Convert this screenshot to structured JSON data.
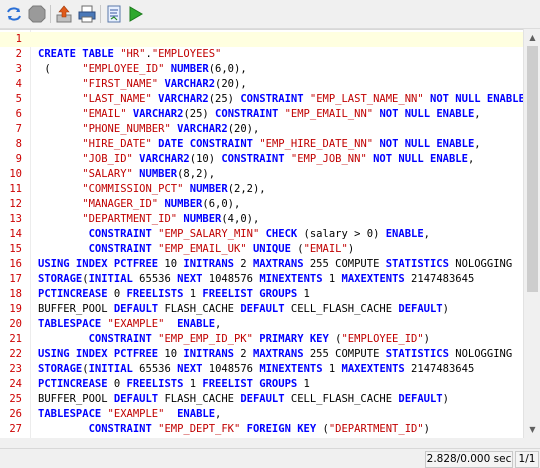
{
  "toolbar": {
    "buttons": [
      "refresh-icon",
      "stop-icon",
      "export-icon",
      "print-icon",
      "explain-plan-icon",
      "run-icon"
    ]
  },
  "editor": {
    "lines": [
      {
        "n": "1",
        "parts": []
      },
      {
        "n": "2",
        "parts": [
          [
            "k",
            "CREATE TABLE "
          ],
          [
            "s",
            "\"HR\""
          ],
          [
            "t",
            "."
          ],
          [
            "s",
            "\"EMPLOYEES\""
          ]
        ]
      },
      {
        "n": "3",
        "parts": [
          [
            "t",
            " (     "
          ],
          [
            "s",
            "\"EMPLOYEE_ID\""
          ],
          [
            "t",
            " "
          ],
          [
            "k",
            "NUMBER"
          ],
          [
            "t",
            "(6,0),"
          ]
        ]
      },
      {
        "n": "4",
        "parts": [
          [
            "t",
            "       "
          ],
          [
            "s",
            "\"FIRST_NAME\""
          ],
          [
            "t",
            " "
          ],
          [
            "k",
            "VARCHAR2"
          ],
          [
            "t",
            "(20),"
          ]
        ]
      },
      {
        "n": "5",
        "parts": [
          [
            "t",
            "       "
          ],
          [
            "s",
            "\"LAST_NAME\""
          ],
          [
            "t",
            " "
          ],
          [
            "k",
            "VARCHAR2"
          ],
          [
            "t",
            "(25) "
          ],
          [
            "k",
            "CONSTRAINT"
          ],
          [
            "t",
            " "
          ],
          [
            "s",
            "\"EMP_LAST_NAME_NN\""
          ],
          [
            "t",
            " "
          ],
          [
            "k",
            "NOT NULL"
          ],
          [
            "t",
            " "
          ],
          [
            "k",
            "ENABLE"
          ],
          [
            "t",
            ","
          ]
        ]
      },
      {
        "n": "6",
        "parts": [
          [
            "t",
            "       "
          ],
          [
            "s",
            "\"EMAIL\""
          ],
          [
            "t",
            " "
          ],
          [
            "k",
            "VARCHAR2"
          ],
          [
            "t",
            "(25) "
          ],
          [
            "k",
            "CONSTRAINT"
          ],
          [
            "t",
            " "
          ],
          [
            "s",
            "\"EMP_EMAIL_NN\""
          ],
          [
            "t",
            " "
          ],
          [
            "k",
            "NOT NULL"
          ],
          [
            "t",
            " "
          ],
          [
            "k",
            "ENABLE"
          ],
          [
            "t",
            ","
          ]
        ]
      },
      {
        "n": "7",
        "parts": [
          [
            "t",
            "       "
          ],
          [
            "s",
            "\"PHONE_NUMBER\""
          ],
          [
            "t",
            " "
          ],
          [
            "k",
            "VARCHAR2"
          ],
          [
            "t",
            "(20),"
          ]
        ]
      },
      {
        "n": "8",
        "parts": [
          [
            "t",
            "       "
          ],
          [
            "s",
            "\"HIRE_DATE\""
          ],
          [
            "t",
            " "
          ],
          [
            "k",
            "DATE"
          ],
          [
            "t",
            " "
          ],
          [
            "k",
            "CONSTRAINT"
          ],
          [
            "t",
            " "
          ],
          [
            "s",
            "\"EMP_HIRE_DATE_NN\""
          ],
          [
            "t",
            " "
          ],
          [
            "k",
            "NOT NULL"
          ],
          [
            "t",
            " "
          ],
          [
            "k",
            "ENABLE"
          ],
          [
            "t",
            ","
          ]
        ]
      },
      {
        "n": "9",
        "parts": [
          [
            "t",
            "       "
          ],
          [
            "s",
            "\"JOB_ID\""
          ],
          [
            "t",
            " "
          ],
          [
            "k",
            "VARCHAR2"
          ],
          [
            "t",
            "(10) "
          ],
          [
            "k",
            "CONSTRAINT"
          ],
          [
            "t",
            " "
          ],
          [
            "s",
            "\"EMP_JOB_NN\""
          ],
          [
            "t",
            " "
          ],
          [
            "k",
            "NOT NULL"
          ],
          [
            "t",
            " "
          ],
          [
            "k",
            "ENABLE"
          ],
          [
            "t",
            ","
          ]
        ]
      },
      {
        "n": "10",
        "parts": [
          [
            "t",
            "       "
          ],
          [
            "s",
            "\"SALARY\""
          ],
          [
            "t",
            " "
          ],
          [
            "k",
            "NUMBER"
          ],
          [
            "t",
            "(8,2),"
          ]
        ]
      },
      {
        "n": "11",
        "parts": [
          [
            "t",
            "       "
          ],
          [
            "s",
            "\"COMMISSION_PCT\""
          ],
          [
            "t",
            " "
          ],
          [
            "k",
            "NUMBER"
          ],
          [
            "t",
            "(2,2),"
          ]
        ]
      },
      {
        "n": "12",
        "parts": [
          [
            "t",
            "       "
          ],
          [
            "s",
            "\"MANAGER_ID\""
          ],
          [
            "t",
            " "
          ],
          [
            "k",
            "NUMBER"
          ],
          [
            "t",
            "(6,0),"
          ]
        ]
      },
      {
        "n": "13",
        "parts": [
          [
            "t",
            "       "
          ],
          [
            "s",
            "\"DEPARTMENT_ID\""
          ],
          [
            "t",
            " "
          ],
          [
            "k",
            "NUMBER"
          ],
          [
            "t",
            "(4,0),"
          ]
        ]
      },
      {
        "n": "14",
        "parts": [
          [
            "t",
            "        "
          ],
          [
            "k",
            "CONSTRAINT"
          ],
          [
            "t",
            " "
          ],
          [
            "s",
            "\"EMP_SALARY_MIN\""
          ],
          [
            "t",
            " "
          ],
          [
            "k",
            "CHECK"
          ],
          [
            "t",
            " (salary > 0) "
          ],
          [
            "k",
            "ENABLE"
          ],
          [
            "t",
            ","
          ]
        ]
      },
      {
        "n": "15",
        "parts": [
          [
            "t",
            "        "
          ],
          [
            "k",
            "CONSTRAINT"
          ],
          [
            "t",
            " "
          ],
          [
            "s",
            "\"EMP_EMAIL_UK\""
          ],
          [
            "t",
            " "
          ],
          [
            "k",
            "UNIQUE"
          ],
          [
            "t",
            " ("
          ],
          [
            "s",
            "\"EMAIL\""
          ],
          [
            "t",
            ")"
          ]
        ]
      },
      {
        "n": "16",
        "parts": [
          [
            "k",
            "USING INDEX PCTFREE"
          ],
          [
            "t",
            " 10 "
          ],
          [
            "k",
            "INITRANS"
          ],
          [
            "t",
            " 2 "
          ],
          [
            "k",
            "MAXTRANS"
          ],
          [
            "t",
            " 255 COMPUTE "
          ],
          [
            "k",
            "STATISTICS"
          ],
          [
            "t",
            " NOLOGGING"
          ]
        ]
      },
      {
        "n": "17",
        "parts": [
          [
            "k",
            "STORAGE"
          ],
          [
            "t",
            "("
          ],
          [
            "k",
            "INITIAL"
          ],
          [
            "t",
            " 65536 "
          ],
          [
            "k",
            "NEXT"
          ],
          [
            "t",
            " 1048576 "
          ],
          [
            "k",
            "MINEXTENTS"
          ],
          [
            "t",
            " 1 "
          ],
          [
            "k",
            "MAXEXTENTS"
          ],
          [
            "t",
            " 2147483645"
          ]
        ]
      },
      {
        "n": "18",
        "parts": [
          [
            "k",
            "PCTINCREASE"
          ],
          [
            "t",
            " 0 "
          ],
          [
            "k",
            "FREELISTS"
          ],
          [
            "t",
            " 1 "
          ],
          [
            "k",
            "FREELIST GROUPS"
          ],
          [
            "t",
            " 1"
          ]
        ]
      },
      {
        "n": "19",
        "parts": [
          [
            "t",
            "BUFFER_POOL "
          ],
          [
            "k",
            "DEFAULT"
          ],
          [
            "t",
            " FLASH_CACHE "
          ],
          [
            "k",
            "DEFAULT"
          ],
          [
            "t",
            " CELL_FLASH_CACHE "
          ],
          [
            "k",
            "DEFAULT"
          ],
          [
            "t",
            ")"
          ]
        ]
      },
      {
        "n": "20",
        "parts": [
          [
            "k",
            "TABLESPACE"
          ],
          [
            "t",
            " "
          ],
          [
            "s",
            "\"EXAMPLE\""
          ],
          [
            "t",
            "  "
          ],
          [
            "k",
            "ENABLE"
          ],
          [
            "t",
            ","
          ]
        ]
      },
      {
        "n": "21",
        "parts": [
          [
            "t",
            "        "
          ],
          [
            "k",
            "CONSTRAINT"
          ],
          [
            "t",
            " "
          ],
          [
            "s",
            "\"EMP_EMP_ID_PK\""
          ],
          [
            "t",
            " "
          ],
          [
            "k",
            "PRIMARY KEY"
          ],
          [
            "t",
            " ("
          ],
          [
            "s",
            "\"EMPLOYEE_ID\""
          ],
          [
            "t",
            ")"
          ]
        ]
      },
      {
        "n": "22",
        "parts": [
          [
            "k",
            "USING INDEX PCTFREE"
          ],
          [
            "t",
            " 10 "
          ],
          [
            "k",
            "INITRANS"
          ],
          [
            "t",
            " 2 "
          ],
          [
            "k",
            "MAXTRANS"
          ],
          [
            "t",
            " 255 COMPUTE "
          ],
          [
            "k",
            "STATISTICS"
          ],
          [
            "t",
            " NOLOGGING"
          ]
        ]
      },
      {
        "n": "23",
        "parts": [
          [
            "k",
            "STORAGE"
          ],
          [
            "t",
            "("
          ],
          [
            "k",
            "INITIAL"
          ],
          [
            "t",
            " 65536 "
          ],
          [
            "k",
            "NEXT"
          ],
          [
            "t",
            " 1048576 "
          ],
          [
            "k",
            "MINEXTENTS"
          ],
          [
            "t",
            " 1 "
          ],
          [
            "k",
            "MAXEXTENTS"
          ],
          [
            "t",
            " 2147483645"
          ]
        ]
      },
      {
        "n": "24",
        "parts": [
          [
            "k",
            "PCTINCREASE"
          ],
          [
            "t",
            " 0 "
          ],
          [
            "k",
            "FREELISTS"
          ],
          [
            "t",
            " 1 "
          ],
          [
            "k",
            "FREELIST GROUPS"
          ],
          [
            "t",
            " 1"
          ]
        ]
      },
      {
        "n": "25",
        "parts": [
          [
            "t",
            "BUFFER_POOL "
          ],
          [
            "k",
            "DEFAULT"
          ],
          [
            "t",
            " FLASH_CACHE "
          ],
          [
            "k",
            "DEFAULT"
          ],
          [
            "t",
            " CELL_FLASH_CACHE "
          ],
          [
            "k",
            "DEFAULT"
          ],
          [
            "t",
            ")"
          ]
        ]
      },
      {
        "n": "26",
        "parts": [
          [
            "k",
            "TABLESPACE"
          ],
          [
            "t",
            " "
          ],
          [
            "s",
            "\"EXAMPLE\""
          ],
          [
            "t",
            "  "
          ],
          [
            "k",
            "ENABLE"
          ],
          [
            "t",
            ","
          ]
        ]
      },
      {
        "n": "27",
        "parts": [
          [
            "t",
            "        "
          ],
          [
            "k",
            "CONSTRAINT"
          ],
          [
            "t",
            " "
          ],
          [
            "s",
            "\"EMP_DEPT_FK\""
          ],
          [
            "t",
            " "
          ],
          [
            "k",
            "FOREIGN KEY"
          ],
          [
            "t",
            " ("
          ],
          [
            "s",
            "\"DEPARTMENT_ID\""
          ],
          [
            "t",
            ")"
          ]
        ]
      }
    ]
  },
  "status": {
    "timing": "2.828/0.000 sec",
    "page": "1/1"
  },
  "colors": {
    "keyword": "#0000ff",
    "string": "#c00000",
    "line_number": "#cc0000",
    "current_line": "#ffffe0"
  }
}
